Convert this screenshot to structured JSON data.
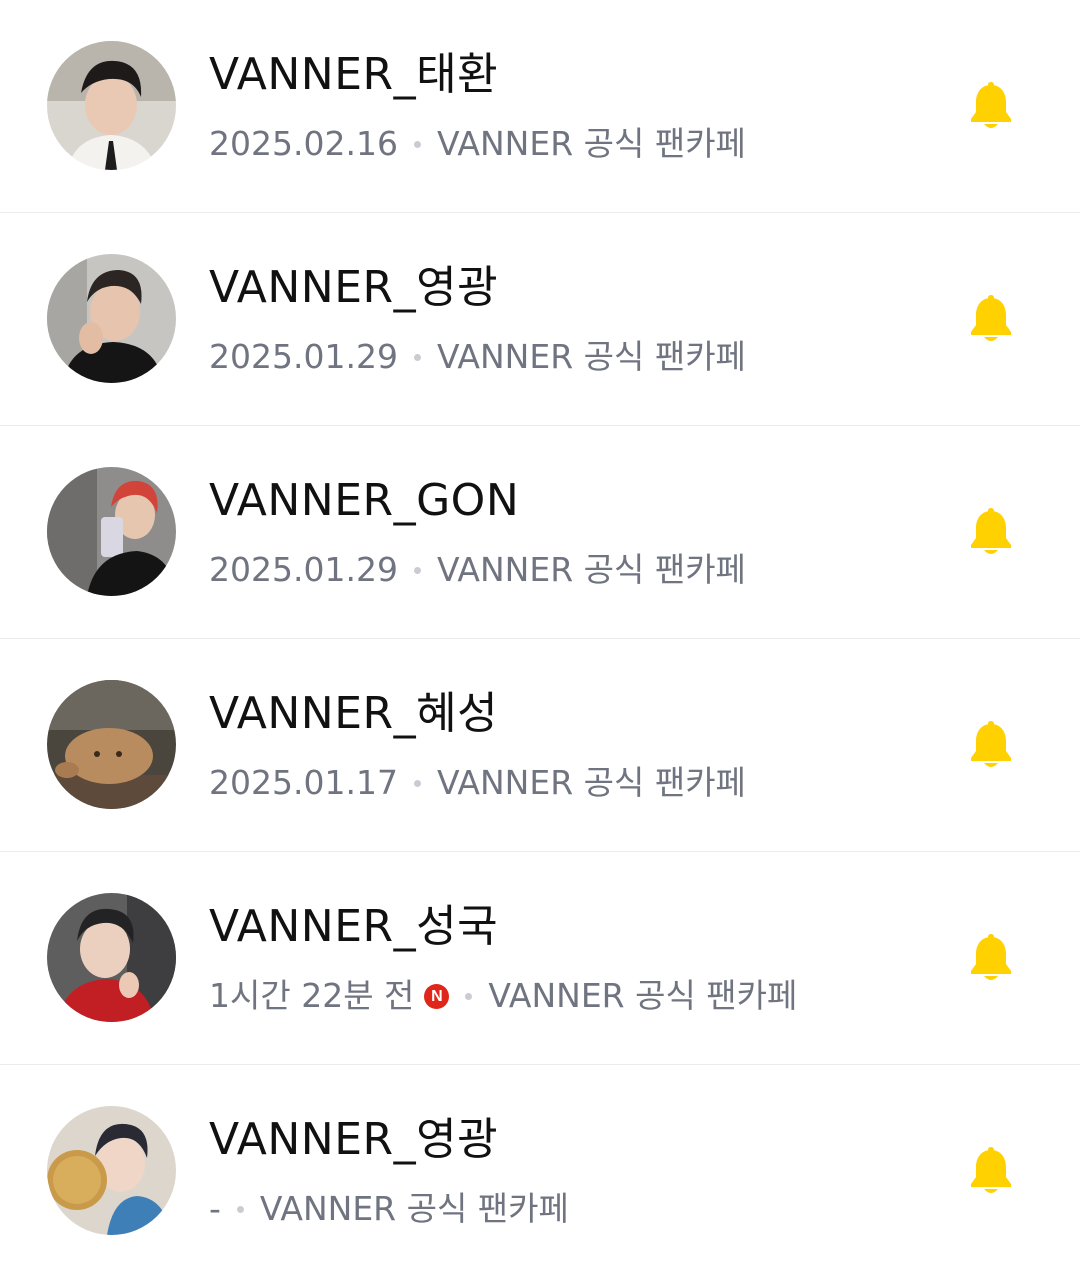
{
  "accent_color": "#FFD100",
  "new_badge_color": "#E0261B",
  "items": [
    {
      "name": "VANNER_태환",
      "date": "2025.02.16",
      "cafe": "VANNER 공식 팬카페",
      "is_new": false,
      "avatar_icon": "profile-photo",
      "bell_icon": "bell-icon"
    },
    {
      "name": "VANNER_영광",
      "date": "2025.01.29",
      "cafe": "VANNER 공식 팬카페",
      "is_new": false,
      "avatar_icon": "profile-photo",
      "bell_icon": "bell-icon"
    },
    {
      "name": "VANNER_GON",
      "date": "2025.01.29",
      "cafe": "VANNER 공식 팬카페",
      "is_new": false,
      "avatar_icon": "profile-photo",
      "bell_icon": "bell-icon"
    },
    {
      "name": "VANNER_혜성",
      "date": "2025.01.17",
      "cafe": "VANNER 공식 팬카페",
      "is_new": false,
      "avatar_icon": "profile-photo",
      "bell_icon": "bell-icon"
    },
    {
      "name": "VANNER_성국",
      "date": "1시간 22분 전",
      "cafe": "VANNER 공식 팬카페",
      "is_new": true,
      "new_label": "N",
      "avatar_icon": "profile-photo",
      "bell_icon": "bell-icon"
    },
    {
      "name": "VANNER_영광",
      "date": "-",
      "cafe": "VANNER 공식 팬카페",
      "is_new": false,
      "avatar_icon": "profile-photo",
      "bell_icon": "bell-icon"
    }
  ]
}
